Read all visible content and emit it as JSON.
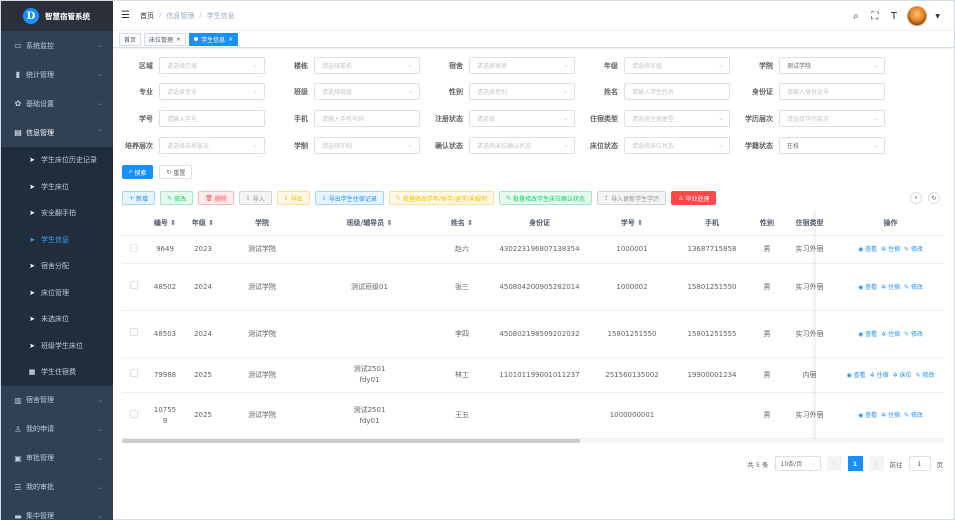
{
  "app": {
    "title": "智慧宿管系统",
    "logo_glyph": "D"
  },
  "sidebar": {
    "items": [
      {
        "label": "系统监控",
        "icon": "monitor-icon"
      },
      {
        "label": "统计管理",
        "icon": "bar-chart-icon"
      },
      {
        "label": "基础设置",
        "icon": "gear-icon"
      },
      {
        "label": "信息管理",
        "icon": "document-icon"
      }
    ],
    "subitems": [
      {
        "label": "学生床位历史记录"
      },
      {
        "label": "学生床位"
      },
      {
        "label": "安全翻手拍"
      },
      {
        "label": "学生信息"
      },
      {
        "label": "宿舍分配"
      },
      {
        "label": "床位管理"
      },
      {
        "label": "未选床位"
      },
      {
        "label": "班级学生床位"
      },
      {
        "label": "学生住宿费"
      }
    ],
    "items_after": [
      {
        "label": "宿舍管理",
        "icon": "building-icon"
      },
      {
        "label": "我的申请",
        "icon": "user-icon"
      },
      {
        "label": "审批管理",
        "icon": "clipboard-icon"
      },
      {
        "label": "我的审批",
        "icon": "checklist-icon"
      },
      {
        "label": "集中管理",
        "icon": "folder-icon"
      }
    ]
  },
  "navbar": {
    "breadcrumb": [
      "首页",
      "信息管理",
      "学生信息"
    ],
    "sep": "/"
  },
  "tags": [
    {
      "label": "首页"
    },
    {
      "label": "床位管理",
      "close": "×"
    },
    {
      "label": "学生信息",
      "close": "×"
    }
  ],
  "filters": {
    "row1": [
      {
        "label": "区域",
        "placeholder": "请选择区域"
      },
      {
        "label": "楼栋",
        "placeholder": "请选择楼栋"
      },
      {
        "label": "宿舍",
        "placeholder": "请选择宿舍"
      },
      {
        "label": "年级",
        "placeholder": "请选择年级"
      },
      {
        "label": "学院",
        "value": "测试学院"
      }
    ],
    "row2": [
      {
        "label": "专业",
        "placeholder": "请选择专业"
      },
      {
        "label": "班级",
        "placeholder": "请选择班级"
      },
      {
        "label": "性别",
        "placeholder": "请选择性别"
      },
      {
        "label": "姓名",
        "placeholder": "请输入学生姓名"
      },
      {
        "label": "身份证",
        "placeholder": "请输入身份证号"
      }
    ],
    "row3": [
      {
        "label": "学号",
        "placeholder": "请输入学号"
      },
      {
        "label": "手机",
        "placeholder": "请输入手机号码"
      },
      {
        "label": "注册状态",
        "placeholder": "请选择"
      },
      {
        "label": "住宿类型",
        "placeholder": "请选择住宿类型"
      },
      {
        "label": "学历层次",
        "placeholder": "请选择学历层次"
      }
    ],
    "row4": [
      {
        "label": "培养层次",
        "placeholder": "请选择培养层次"
      },
      {
        "label": "学制",
        "placeholder": "请选择学制"
      },
      {
        "label": "确认状态",
        "placeholder": "请选择床位确认状态"
      },
      {
        "label": "床位状态",
        "placeholder": "请选择床位状态"
      },
      {
        "label": "学籍状态",
        "value": "在校"
      }
    ],
    "search_label": "搜索",
    "reset_label": "重置"
  },
  "toolbar": {
    "add": "新增",
    "edit": "修改",
    "delete": "删除",
    "import": "导入",
    "export": "导出",
    "export_records": "导出学生住宿记录",
    "batch_edit": "批量修改学年/休学/退学/未报到",
    "batch_confirm": "批量修改学生床位确认状态",
    "import_update": "导入更新学生学历",
    "graduate": "毕业处理"
  },
  "table": {
    "headers": [
      "编号",
      "年级",
      "学院",
      "班级/辅导员",
      "姓名",
      "身份证",
      "学号",
      "手机",
      "性别",
      "住宿类型",
      "操作"
    ],
    "sort_glyph": "⇕",
    "rows": [
      {
        "id": "9649",
        "grade": "2023",
        "college": "测试学院",
        "class": "",
        "name": "赵六",
        "idcard": "430223196807138354",
        "stuno": "1000001",
        "phone": "13687715858",
        "gender": "男",
        "type": "实习外宿",
        "ops": [
          "查看",
          "住宿",
          "修改"
        ]
      },
      {
        "id": "48502",
        "grade": "2024",
        "college": "测试学院",
        "class": "测试班级01",
        "name": "张三",
        "idcard": "450804200905282014",
        "stuno": "1000002",
        "phone": "15801251550",
        "gender": "男",
        "type": "实习外宿",
        "ops": [
          "查看",
          "住宿",
          "修改"
        ]
      },
      {
        "id": "48503",
        "grade": "2024",
        "college": "测试学院",
        "class": "",
        "name": "李四",
        "idcard": "450802198509202032",
        "stuno": "15801251550",
        "phone": "15801251555",
        "gender": "男",
        "type": "实习外宿",
        "ops": [
          "查看",
          "住宿",
          "修改"
        ]
      },
      {
        "id": "79988",
        "grade": "2025",
        "college": "测试学院",
        "class": "测试2501",
        "class2": "fdy01",
        "name": "林工",
        "idcard": "110101199001011237",
        "stuno": "251560135002",
        "phone": "19900001234",
        "gender": "男",
        "type": "内宿",
        "ops": [
          "查看",
          "住宿",
          "床位",
          "修改"
        ]
      },
      {
        "id": "10755",
        "id2": "9",
        "grade": "2025",
        "college": "测试学院",
        "class": "测试2501",
        "class2": "fdy01",
        "name": "王五",
        "idcard": "",
        "stuno": "1000000001",
        "phone": "",
        "gender": "男",
        "type": "实习外宿",
        "ops": [
          "查看",
          "住宿",
          "修改"
        ]
      }
    ]
  },
  "pagination": {
    "total_text": "共 5 条",
    "page_size": "10条/页",
    "current": "1",
    "goto_label": "前往",
    "goto_value": "1",
    "page_unit": "页"
  },
  "colors": {
    "primary": "#1890ff",
    "sidebar": "#304156"
  }
}
